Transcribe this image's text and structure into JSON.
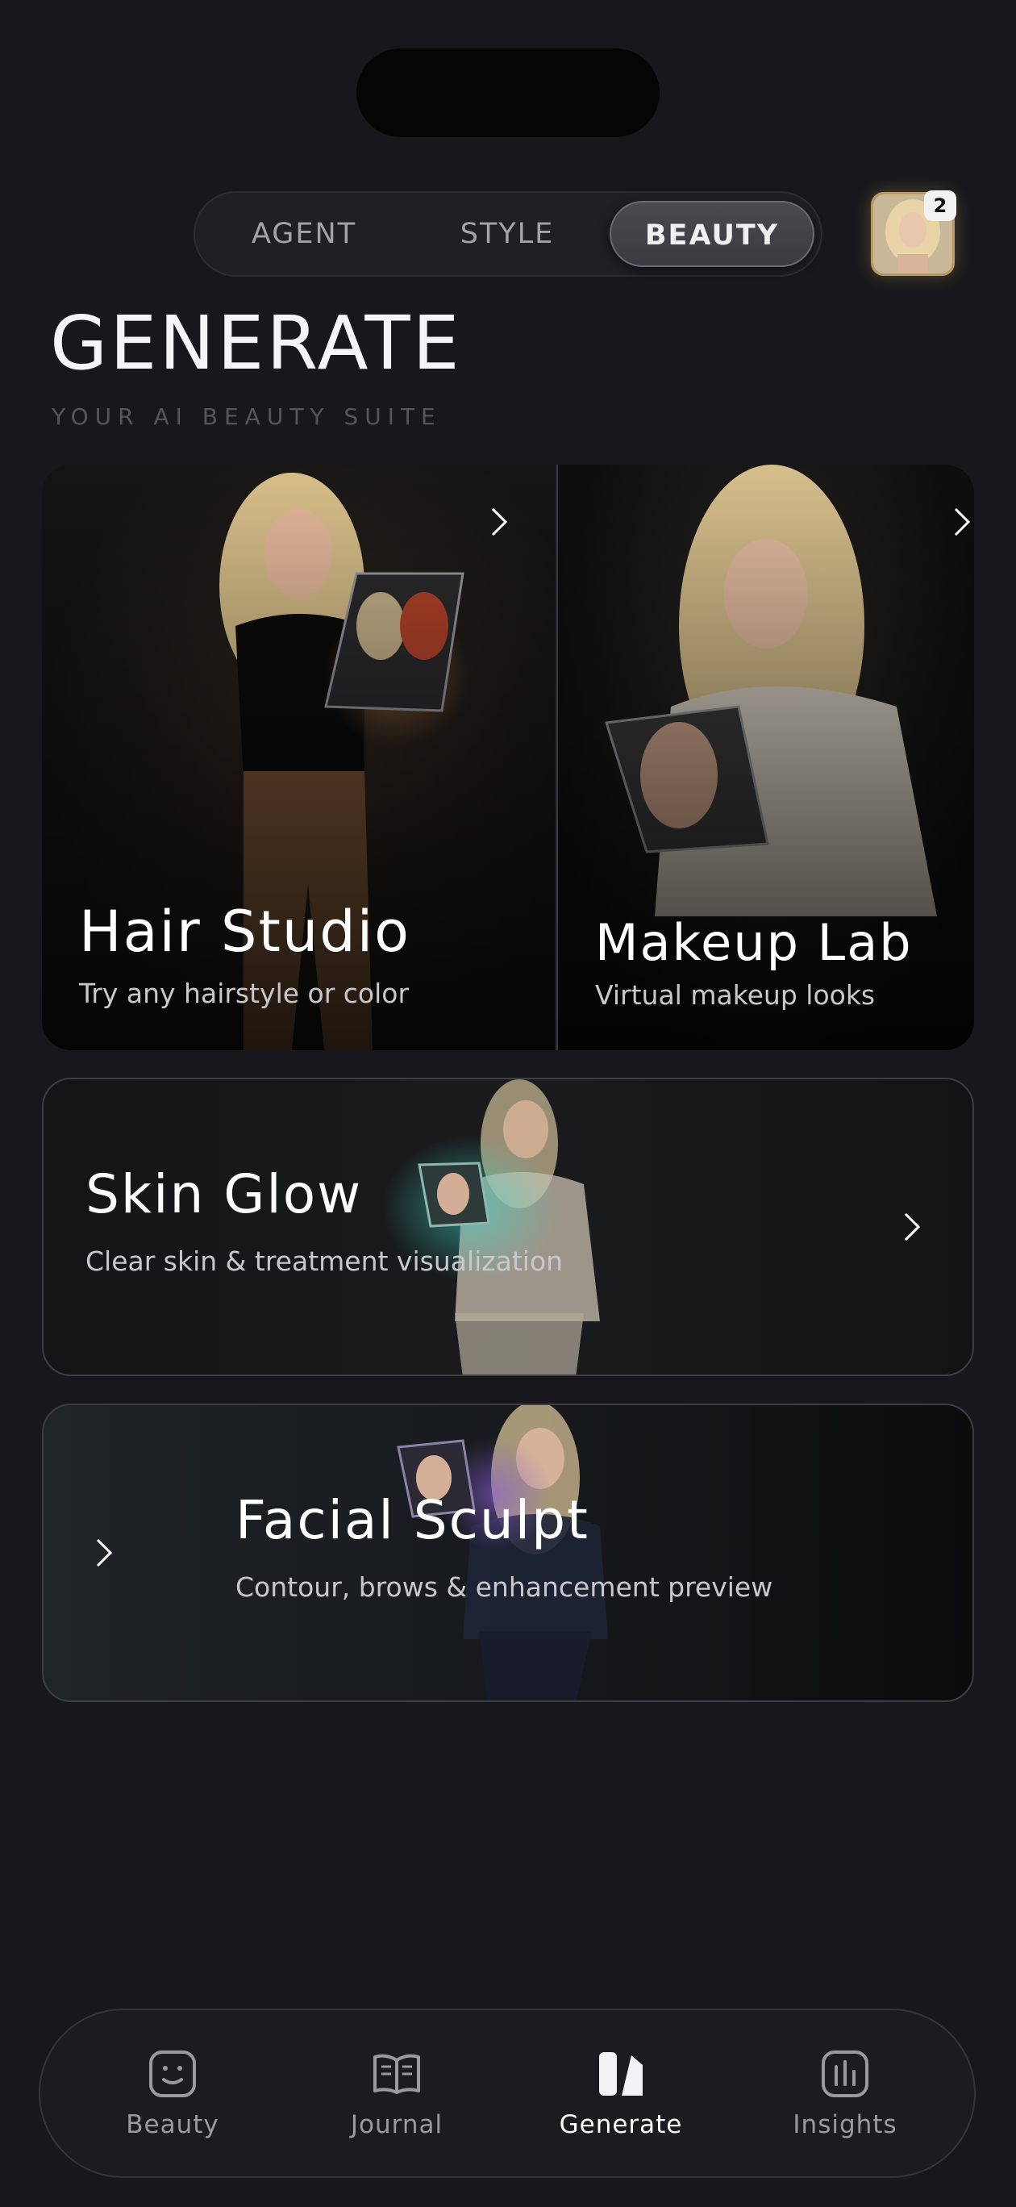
{
  "header": {
    "segments": [
      "AGENT",
      "STYLE",
      "BEAUTY"
    ],
    "active_segment": "BEAUTY",
    "profile_badge": "2"
  },
  "page": {
    "title": "GENERATE",
    "subtitle": "YOUR AI BEAUTY SUITE"
  },
  "cards": {
    "hair": {
      "title": "Hair Studio",
      "subtitle": "Try any hairstyle or color"
    },
    "makeup": {
      "title": "Makeup Lab",
      "subtitle": "Virtual makeup looks"
    },
    "skin": {
      "title": "Skin Glow",
      "subtitle": "Clear skin & treatment visualization"
    },
    "facial": {
      "title": "Facial Sculpt",
      "subtitle": "Contour, brows & enhancement preview"
    }
  },
  "tabbar": {
    "items": [
      {
        "label": "Beauty",
        "icon": "face-scan-icon"
      },
      {
        "label": "Journal",
        "icon": "book-icon"
      },
      {
        "label": "Generate",
        "icon": "generate-icon"
      },
      {
        "label": "Insights",
        "icon": "bar-chart-icon"
      }
    ],
    "active": "Generate"
  },
  "colors": {
    "background": "#18181c",
    "accent_gold": "#b89a63",
    "text_primary": "#ffffff",
    "text_muted": "#9a9aa0"
  }
}
